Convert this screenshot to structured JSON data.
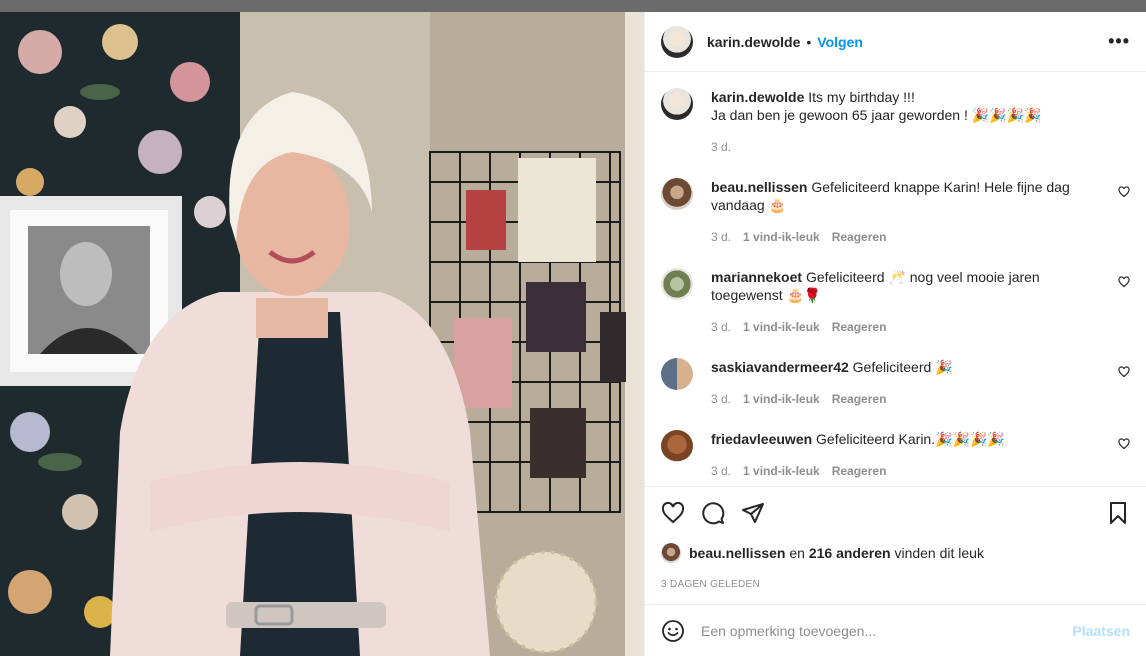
{
  "colors": {
    "accent": "#0095f6",
    "post_disabled": "#b2dffc",
    "muted": "#8e8e8e"
  },
  "header": {
    "username": "karin.dewolde",
    "dot": "•",
    "follow_label": "Volgen",
    "more_icon": "•••"
  },
  "caption": {
    "username": "karin.dewolde",
    "line1": "Its my birthday !!!",
    "line2": "Ja dan ben je gewoon 65 jaar geworden ! 🎉🎉🎉🎉",
    "time": "3 d."
  },
  "comments": [
    {
      "username": "beau.nellissen",
      "text": "Gefeliciteerd knappe Karin! Hele fijne dag vandaag 🎂",
      "time": "3 d.",
      "likes": "1 vind-ik-leuk",
      "reply": "Reageren"
    },
    {
      "username": "mariannekoet",
      "text": "Gefeliciteerd 🥂 nog veel mooie jaren toegewenst 🎂🌹",
      "time": "3 d.",
      "likes": "1 vind-ik-leuk",
      "reply": "Reageren"
    },
    {
      "username": "saskiavandermeer42",
      "text": "Gefeliciteerd 🎉",
      "time": "3 d.",
      "likes": "1 vind-ik-leuk",
      "reply": "Reageren"
    },
    {
      "username": "friedavleeuwen",
      "text": "Gefeliciteerd Karin.🎉🎉🎉🎉",
      "time": "3 d.",
      "likes": "1 vind-ik-leuk",
      "reply": "Reageren"
    }
  ],
  "likes": {
    "first_user": "beau.nellissen",
    "middle": "en",
    "others": "216 anderen",
    "suffix": "vinden dit leuk"
  },
  "posted_ago": "3 DAGEN GELEDEN",
  "add_comment": {
    "placeholder": "Een opmerking toevoegen...",
    "post_label": "Plaatsen"
  }
}
